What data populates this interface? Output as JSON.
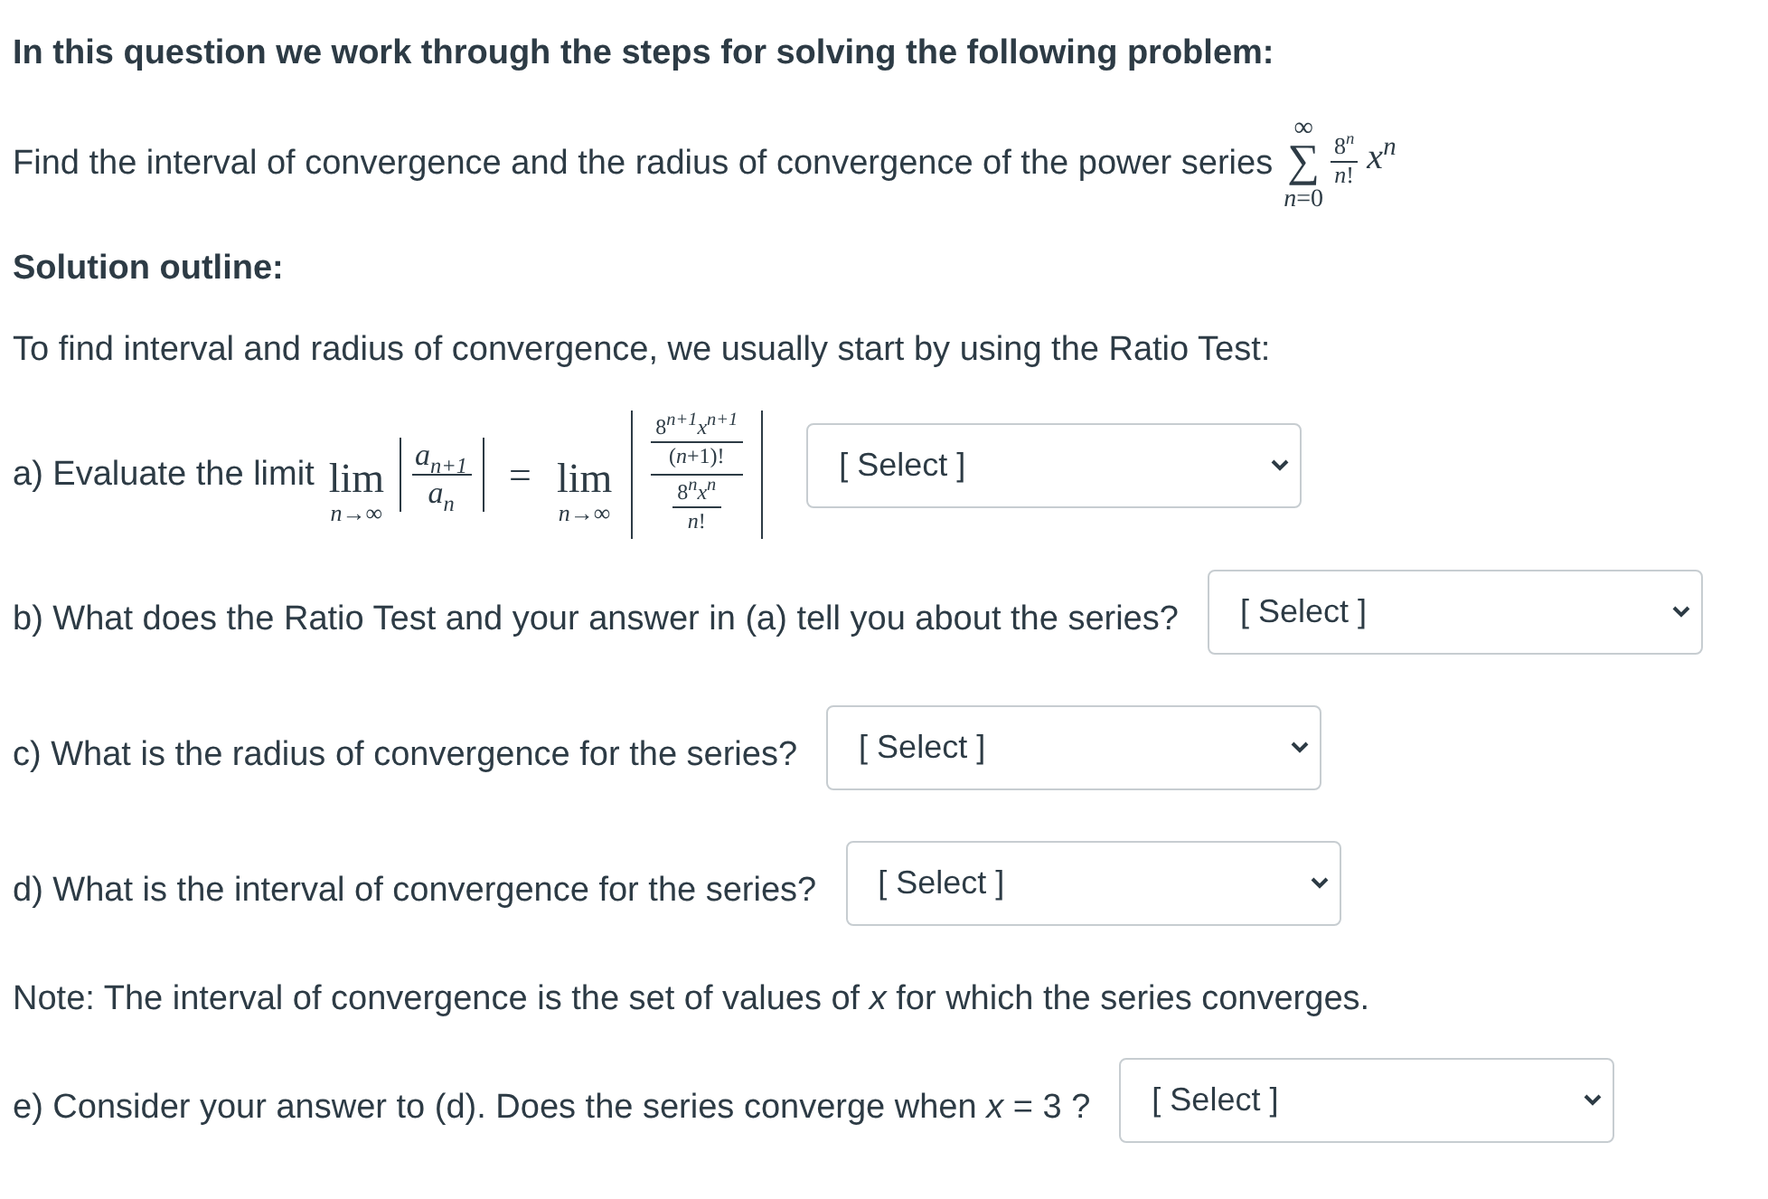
{
  "intro": "In this question we work through the steps for solving the following problem:",
  "problem": {
    "text": "Find the interval of convergence and the radius of convergence of the power series",
    "series": {
      "upper": "∞",
      "operator": "∑",
      "lower": "*n*=0",
      "numerator": "8$^{n}$",
      "denominator": "*n*!",
      "term": "*x*$^{n}$"
    }
  },
  "solution_heading": "Solution outline:",
  "instructions": "To find interval and radius of convergence, we usually start by using the Ratio Test:",
  "parts": [
    {
      "kind": "limit",
      "label": "a) Evaluate the limit",
      "math": {
        "left": {
          "operator": "lim",
          "under": "*n*→∞",
          "numerator": "*a*$_{n+1}$",
          "denominator": "*a*$_{n}$"
        },
        "relation": "=",
        "right": {
          "operator": "lim",
          "under": "*n*→∞",
          "numerator": {
            "numerator": "8$^{n+1}$*x*$^{n+1}$",
            "denominator": "(*n*+1)!"
          },
          "denominator": {
            "numerator": "8$^{n}$*x*$^{n}$",
            "denominator": "*n*!"
          }
        }
      },
      "dropdown": {
        "value": "[ Select ]"
      }
    },
    {
      "kind": "question",
      "label": "b) What does the Ratio Test and your answer in (a) tell you about the series?",
      "dropdown": {
        "value": "[ Select ]"
      }
    },
    {
      "kind": "question",
      "label": "c) What is the radius of convergence for the series?",
      "dropdown": {
        "value": "[ Select ]"
      }
    },
    {
      "kind": "question",
      "label": "d) What is the interval of convergence for the series?",
      "dropdown": {
        "value": "[ Select ]"
      }
    },
    {
      "kind": "note",
      "text": "Note: The interval of convergence is the set of values of *x* for which the series converges."
    },
    {
      "kind": "question",
      "label": "e) Consider your answer to (d). Does the series converge when *x* = 3 ?",
      "dropdown": {
        "value": "[ Select ]"
      }
    }
  ]
}
